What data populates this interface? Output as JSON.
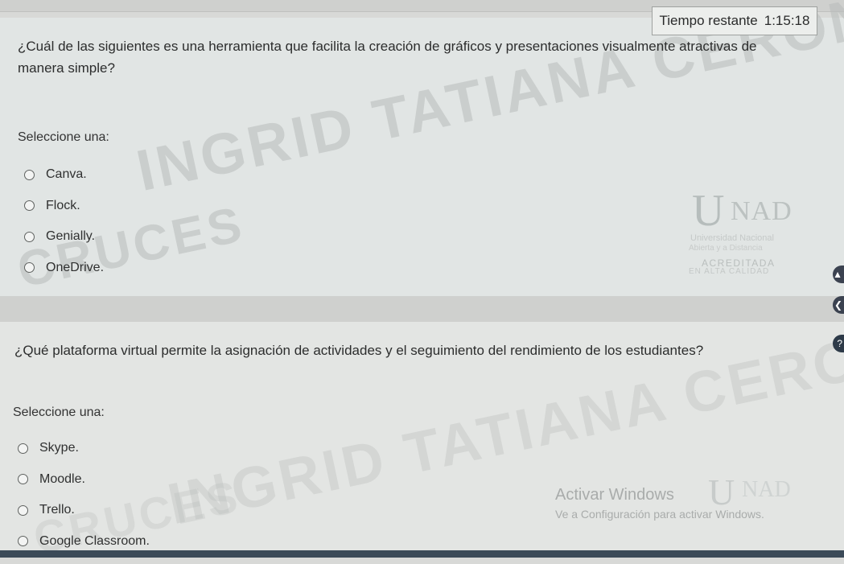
{
  "timer": {
    "label": "Tiempo restante",
    "value": "1:15:18"
  },
  "q1": {
    "text": "¿Cuál de las siguientes es una herramienta que facilita la creación de gráficos y presentaciones visualmente atractivas de manera simple?",
    "prompt": "Seleccione una:",
    "options": [
      "Canva.",
      "Flock.",
      "Genially.",
      "OneDrive."
    ]
  },
  "q2": {
    "text": "¿Qué plataforma virtual permite la asignación de actividades y el seguimiento del rendimiento de los estudiantes?",
    "prompt": "Seleccione una:",
    "options": [
      "Skype.",
      "Moodle.",
      "Trello.",
      "Google Classroom."
    ]
  },
  "watermark": {
    "name": "INGRID TATIANA CERON",
    "surname": "CRUCES",
    "name2": "INGRID TATIANA CERON",
    "surname2": "CRUCES"
  },
  "logo": {
    "u": "U",
    "nad": "NAD",
    "university": "Universidad Nacional",
    "subtitle": "Abierta y a Distancia",
    "accredited": "ACREDITADA",
    "quality": "EN ALTA CALIDAD"
  },
  "activate_windows": {
    "title": "Activar Windows",
    "subtitle": "Ve a Configuración para activar Windows."
  },
  "icons": {
    "up": "chevron-up-icon",
    "left": "chevron-left-icon",
    "help": "help-icon"
  }
}
